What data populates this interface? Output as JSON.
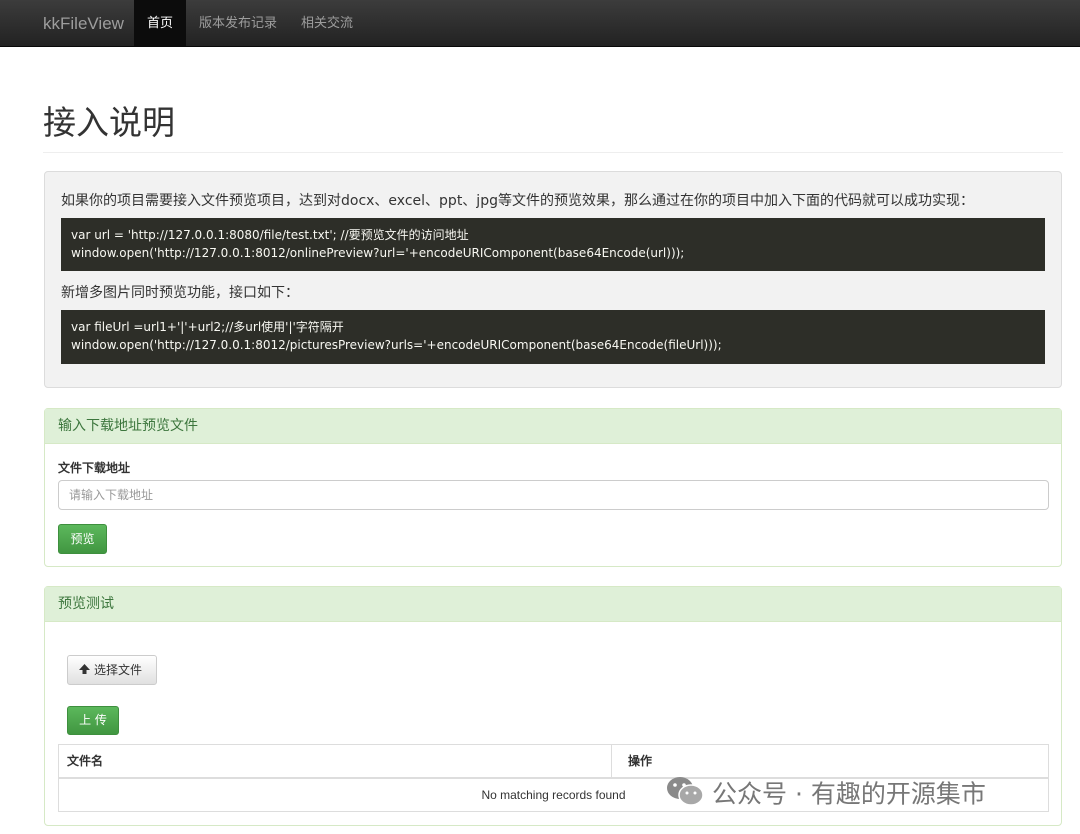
{
  "navbar": {
    "brand": "kkFileView",
    "items": [
      {
        "label": "首页",
        "active": true
      },
      {
        "label": "版本发布记录",
        "active": false
      },
      {
        "label": "相关交流",
        "active": false
      }
    ]
  },
  "page": {
    "title": "接入说明"
  },
  "intro": {
    "text1": "如果你的项目需要接入文件预览项目，达到对docx、excel、ppt、jpg等文件的预览效果，那么通过在你的项目中加入下面的代码就可以成功实现：",
    "code1": [
      "var url = 'http://127.0.0.1:8080/file/test.txt'; //要预览文件的访问地址",
      "window.open('http://127.0.0.1:8012/onlinePreview?url='+encodeURIComponent(base64Encode(url)));"
    ],
    "text2": "新增多图片同时预览功能，接口如下：",
    "code2": [
      "var fileUrl =url1+'|'+url2;//多url使用'|'字符隔开",
      "window.open('http://127.0.0.1:8012/picturesPreview?urls='+encodeURIComponent(base64Encode(fileUrl)));"
    ]
  },
  "download_panel": {
    "heading": "输入下载地址预览文件",
    "field_label": "文件下载地址",
    "input_placeholder": "请输入下载地址",
    "preview_button": "预览"
  },
  "test_panel": {
    "heading": "预览测试",
    "choose_file_button": "选择文件",
    "upload_button": "上 传",
    "table": {
      "columns": [
        "文件名",
        "操作"
      ],
      "empty_message": "No matching records found"
    }
  },
  "watermark": {
    "text": "公众号 · 有趣的开源集市",
    "icon": "wechat-icon"
  },
  "colors": {
    "navbar": "#222222",
    "panel_heading_bg": "#dff0d8",
    "panel_heading_text": "#3c763d",
    "success": "#5cb85c",
    "code_bg": "#2d2e28"
  }
}
